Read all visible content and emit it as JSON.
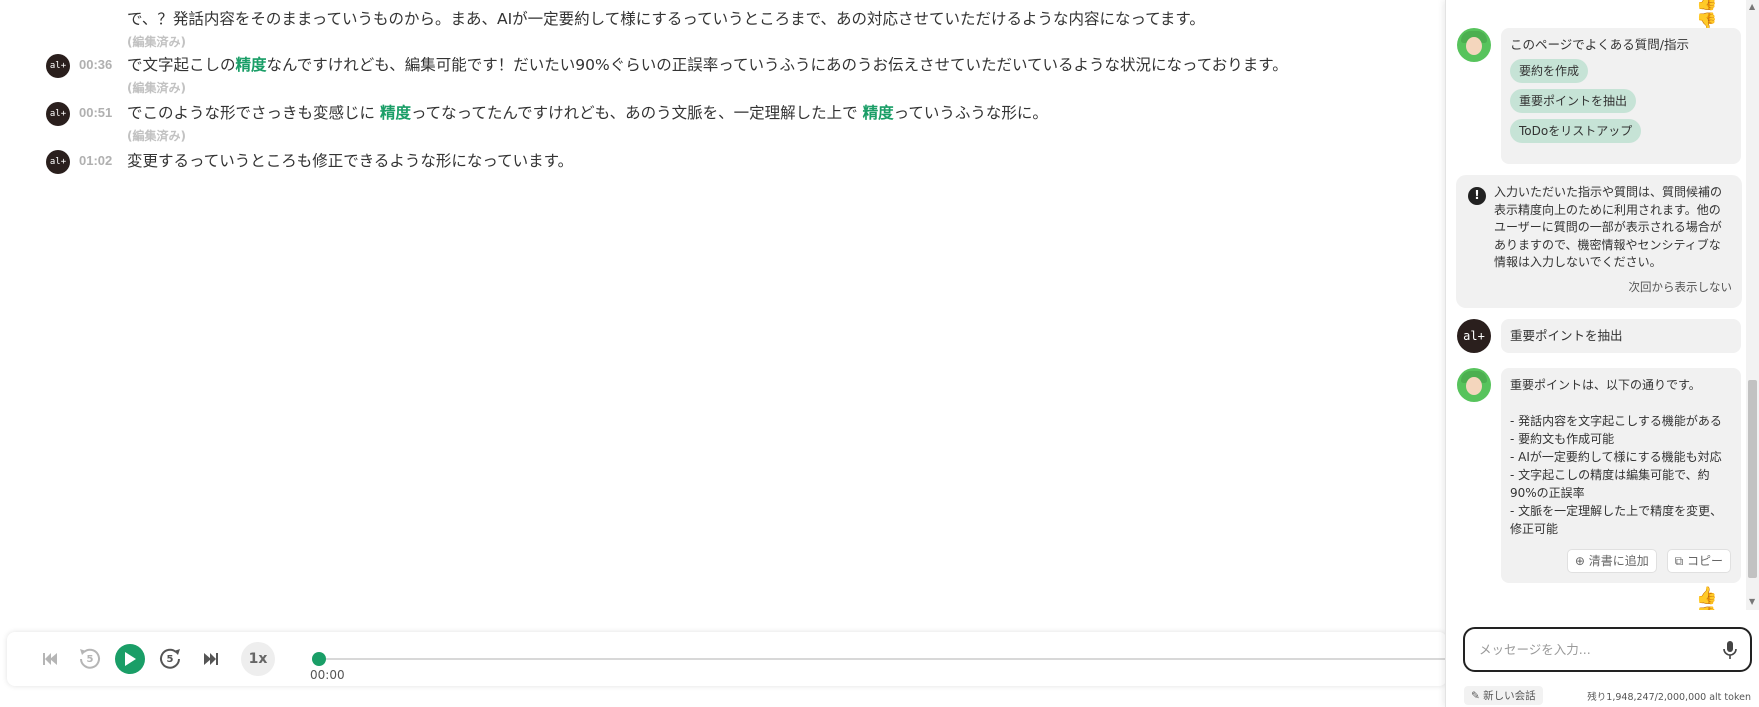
{
  "transcript": {
    "segments": [
      {
        "time": "",
        "text": "で、？発話内容をそのままっていうものから。まあ、AIが一定要約して様にするっていうところまで、あの対応させていただけるような内容になってます。",
        "edited": "(編集済み)"
      },
      {
        "time": "00:36",
        "pre": "で文字起こしの",
        "hl1": "精度",
        "mid": "なんですけれども、編集可能です！だいたい90%ぐらいの正誤率っていうふうにあのうお伝えさせていただいているような状況になっております。",
        "hl2": "",
        "post": "",
        "edited": "(編集済み)"
      },
      {
        "time": "00:51",
        "pre": "でこのような形でさっきも変感じに ",
        "hl1": "精度",
        "mid": "ってなってたんですけれども、あのう文脈を、一定理解した上で ",
        "hl2": "精度",
        "post": "っていうふうな形に。",
        "edited": "(編集済み)"
      },
      {
        "time": "01:02",
        "text": "変更するっていうところも修正できるような形になっています。"
      }
    ],
    "avatar_label": "al+"
  },
  "player": {
    "speed": "1x",
    "current_time": "00:00",
    "progress_fraction": 0.0,
    "skip_seconds": "5"
  },
  "chat": {
    "faq": {
      "title": "このページでよくある質問/指示",
      "chips": [
        "要約を作成",
        "重要ポイントを抽出",
        "ToDoをリストアップ"
      ]
    },
    "notice": {
      "text": "入力いただいた指示や質問は、質問候補の表示精度向上のために利用されます。他のユーザーに質問の一部が表示される場合がありますので、機密情報やセンシティブな情報は入力しないでください。",
      "dismiss": "次回から表示しない"
    },
    "user_message": "重要ポイントを抽出",
    "user_avatar": "al+",
    "answer": {
      "intro": "重要ポイントは、以下の通りです。",
      "points": [
        "- 発話内容を文字起こしする機能がある",
        "- 要約文も作成可能",
        "- AIが一定要約して様にする機能も対応",
        "- 文字起こしの精度は編集可能で、約90%の正誤率",
        "- 文脈を一定理解した上で精度を変更、修正可能"
      ],
      "add_label": "清書に追加",
      "copy_label": "コピー"
    },
    "input": {
      "placeholder": "メッセージを入力..."
    },
    "new_chat_label": "新しい会話",
    "token_info": "残り1,948,247/2,000,000 alt token"
  },
  "colors": {
    "accent": "#1a9e67",
    "chip": "#c6e3d6",
    "bubble": "#f1f1f1"
  }
}
